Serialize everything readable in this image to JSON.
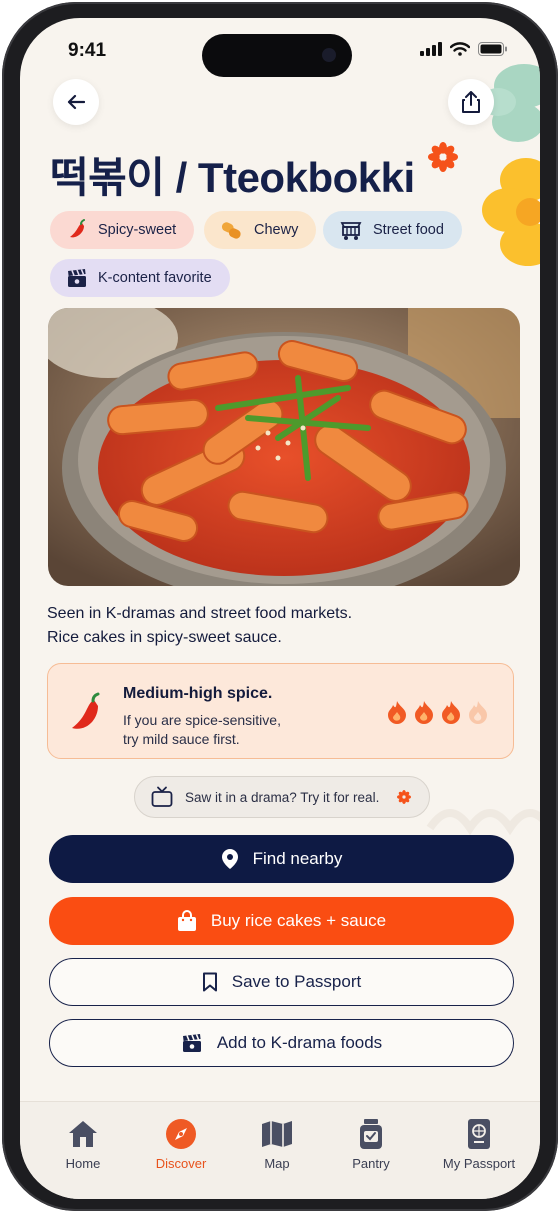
{
  "status_bar": {
    "time": "9:41"
  },
  "header": {
    "title": "떡볶이 / Tteokbokki"
  },
  "tags": [
    {
      "label": "Spicy-sweet",
      "icon": "chili-icon",
      "color": "#fbd9d2"
    },
    {
      "label": "Chewy",
      "icon": "rice-cake-icon",
      "color": "#fbe6cc"
    },
    {
      "label": "Street food",
      "icon": "food-cart-icon",
      "color": "#d9e6f0"
    },
    {
      "label": "K-content favorite",
      "icon": "clapperboard-icon",
      "color": "#e3ddf3"
    }
  ],
  "description": {
    "line1": "Seen in K-dramas and street food markets.",
    "line2": "Rice cakes in spicy-sweet sauce."
  },
  "spice": {
    "title": "Medium-high spice.",
    "line1": "If you are spice-sensitive,",
    "line2": "try mild sauce first.",
    "level": 3,
    "max": 4
  },
  "drama_prompt": "Saw it in a drama? Try it for real.",
  "actions": {
    "find_nearby": "Find nearby",
    "buy": "Buy rice cakes + sauce",
    "save": "Save to Passport",
    "add_drama": "Add to K-drama foods"
  },
  "tabs": [
    {
      "label": "Home",
      "icon": "home-icon",
      "active": false
    },
    {
      "label": "Discover",
      "icon": "compass-icon",
      "active": true
    },
    {
      "label": "Map",
      "icon": "map-icon",
      "active": false
    },
    {
      "label": "Pantry",
      "icon": "pantry-jar-icon",
      "active": false
    },
    {
      "label": "My Passport",
      "icon": "passport-icon",
      "active": false
    }
  ],
  "colors": {
    "navy": "#0e1a44",
    "orange": "#fa4d12",
    "background": "#f8f4ee",
    "accent_flower": "#fbc02d"
  }
}
